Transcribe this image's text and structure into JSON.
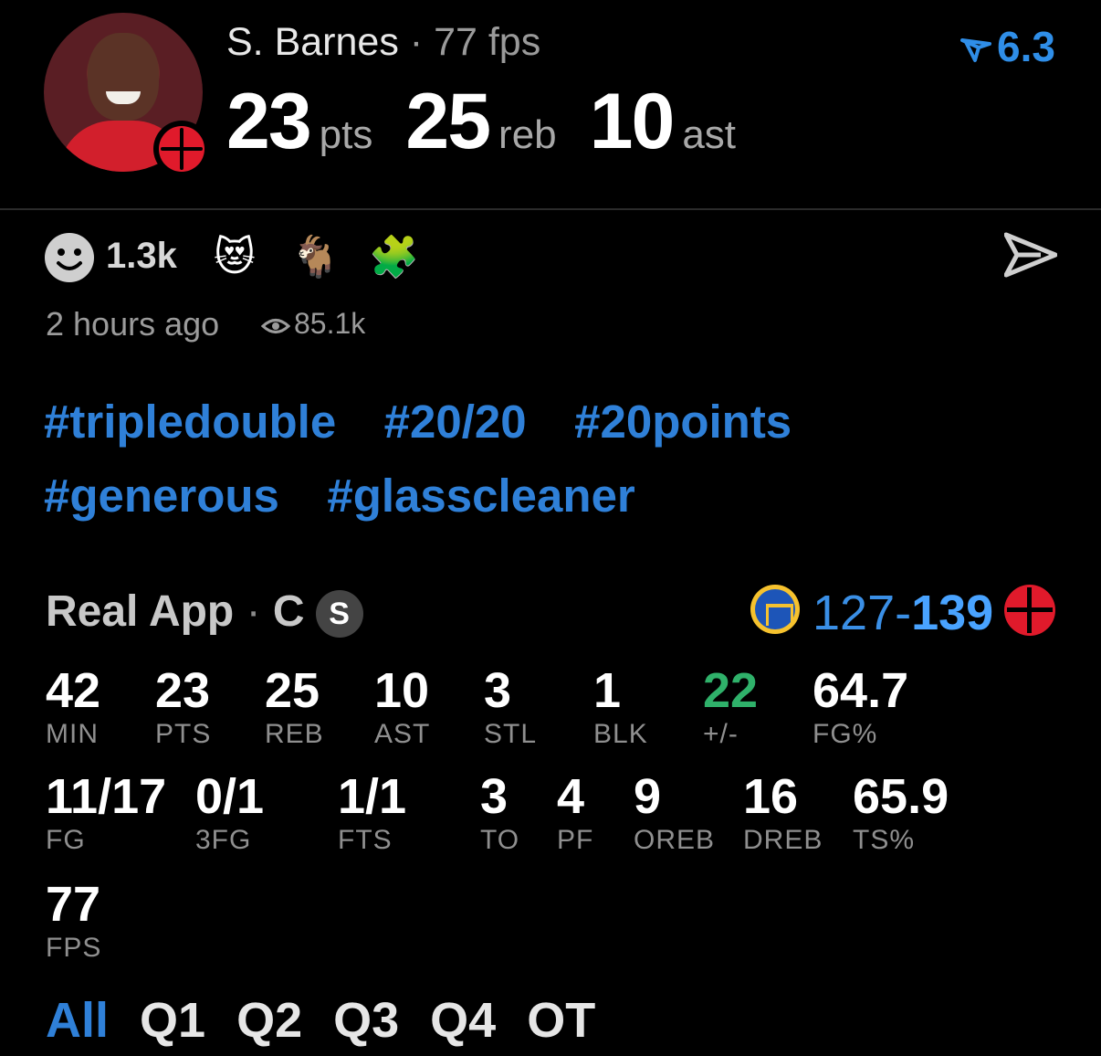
{
  "player": {
    "name": "S. Barnes",
    "separator": "·",
    "fps_label": "77 fps",
    "rating": "6.3",
    "headline": [
      {
        "value": "23",
        "unit": "pts"
      },
      {
        "value": "25",
        "unit": "reb"
      },
      {
        "value": "10",
        "unit": "ast"
      }
    ]
  },
  "reactions": {
    "count": "1.3k",
    "emojis": [
      "😻",
      "🐐",
      "🧩"
    ],
    "time": "2 hours ago",
    "views": "85.1k"
  },
  "hashtags": [
    "#tripledouble",
    "#20/20",
    "#20points",
    "#generous",
    "#glasscleaner"
  ],
  "source": {
    "app": "Real App",
    "separator": "·",
    "position": "C",
    "badge": "S"
  },
  "game": {
    "away_score": "127",
    "dash": "-",
    "home_score": "139"
  },
  "stats": {
    "row1": [
      {
        "value": "42",
        "label": "MIN"
      },
      {
        "value": "23",
        "label": "PTS"
      },
      {
        "value": "25",
        "label": "REB"
      },
      {
        "value": "10",
        "label": "AST"
      },
      {
        "value": "3",
        "label": "STL"
      },
      {
        "value": "1",
        "label": "BLK"
      },
      {
        "value": "22",
        "label": "+/-"
      },
      {
        "value": "64.7",
        "label": "FG%"
      }
    ],
    "row2": [
      {
        "value": "11/17",
        "label": "FG"
      },
      {
        "value": "0/1",
        "label": "3FG"
      },
      {
        "value": "1/1",
        "label": "FTS"
      },
      {
        "value": "3",
        "label": "TO"
      },
      {
        "value": "4",
        "label": "PF"
      },
      {
        "value": "9",
        "label": "OREB"
      },
      {
        "value": "16",
        "label": "DREB"
      },
      {
        "value": "65.9",
        "label": "TS%"
      }
    ],
    "row3": [
      {
        "value": "77",
        "label": "FPS"
      }
    ]
  },
  "periods": [
    "All",
    "Q1",
    "Q2",
    "Q3",
    "Q4",
    "OT"
  ],
  "colors": {
    "accent": "#2f80d8",
    "positive": "#2fb16a",
    "background": "#000000"
  }
}
